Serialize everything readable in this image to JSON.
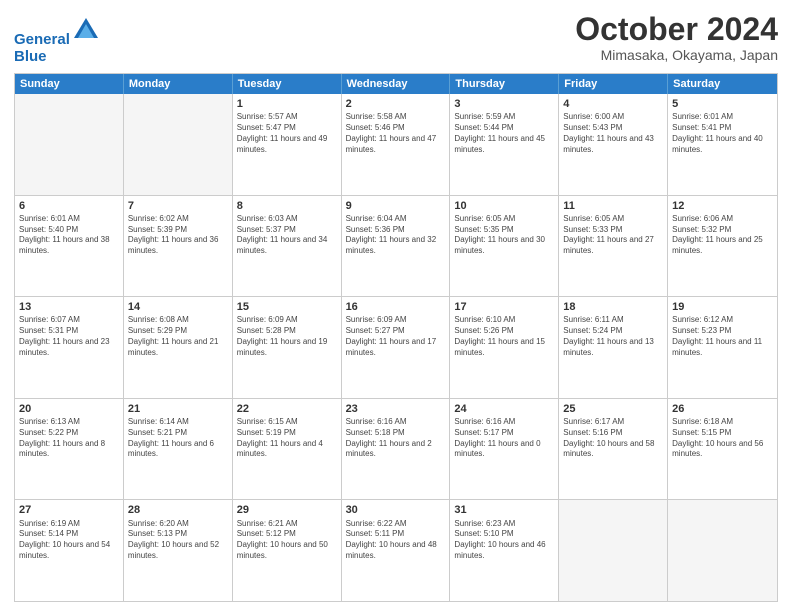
{
  "logo": {
    "line1": "General",
    "line2": "Blue"
  },
  "title": "October 2024",
  "subtitle": "Mimasaka, Okayama, Japan",
  "header_days": [
    "Sunday",
    "Monday",
    "Tuesday",
    "Wednesday",
    "Thursday",
    "Friday",
    "Saturday"
  ],
  "weeks": [
    [
      {
        "day": "",
        "info": ""
      },
      {
        "day": "",
        "info": ""
      },
      {
        "day": "1",
        "info": "Sunrise: 5:57 AM\nSunset: 5:47 PM\nDaylight: 11 hours and 49 minutes."
      },
      {
        "day": "2",
        "info": "Sunrise: 5:58 AM\nSunset: 5:46 PM\nDaylight: 11 hours and 47 minutes."
      },
      {
        "day": "3",
        "info": "Sunrise: 5:59 AM\nSunset: 5:44 PM\nDaylight: 11 hours and 45 minutes."
      },
      {
        "day": "4",
        "info": "Sunrise: 6:00 AM\nSunset: 5:43 PM\nDaylight: 11 hours and 43 minutes."
      },
      {
        "day": "5",
        "info": "Sunrise: 6:01 AM\nSunset: 5:41 PM\nDaylight: 11 hours and 40 minutes."
      }
    ],
    [
      {
        "day": "6",
        "info": "Sunrise: 6:01 AM\nSunset: 5:40 PM\nDaylight: 11 hours and 38 minutes."
      },
      {
        "day": "7",
        "info": "Sunrise: 6:02 AM\nSunset: 5:39 PM\nDaylight: 11 hours and 36 minutes."
      },
      {
        "day": "8",
        "info": "Sunrise: 6:03 AM\nSunset: 5:37 PM\nDaylight: 11 hours and 34 minutes."
      },
      {
        "day": "9",
        "info": "Sunrise: 6:04 AM\nSunset: 5:36 PM\nDaylight: 11 hours and 32 minutes."
      },
      {
        "day": "10",
        "info": "Sunrise: 6:05 AM\nSunset: 5:35 PM\nDaylight: 11 hours and 30 minutes."
      },
      {
        "day": "11",
        "info": "Sunrise: 6:05 AM\nSunset: 5:33 PM\nDaylight: 11 hours and 27 minutes."
      },
      {
        "day": "12",
        "info": "Sunrise: 6:06 AM\nSunset: 5:32 PM\nDaylight: 11 hours and 25 minutes."
      }
    ],
    [
      {
        "day": "13",
        "info": "Sunrise: 6:07 AM\nSunset: 5:31 PM\nDaylight: 11 hours and 23 minutes."
      },
      {
        "day": "14",
        "info": "Sunrise: 6:08 AM\nSunset: 5:29 PM\nDaylight: 11 hours and 21 minutes."
      },
      {
        "day": "15",
        "info": "Sunrise: 6:09 AM\nSunset: 5:28 PM\nDaylight: 11 hours and 19 minutes."
      },
      {
        "day": "16",
        "info": "Sunrise: 6:09 AM\nSunset: 5:27 PM\nDaylight: 11 hours and 17 minutes."
      },
      {
        "day": "17",
        "info": "Sunrise: 6:10 AM\nSunset: 5:26 PM\nDaylight: 11 hours and 15 minutes."
      },
      {
        "day": "18",
        "info": "Sunrise: 6:11 AM\nSunset: 5:24 PM\nDaylight: 11 hours and 13 minutes."
      },
      {
        "day": "19",
        "info": "Sunrise: 6:12 AM\nSunset: 5:23 PM\nDaylight: 11 hours and 11 minutes."
      }
    ],
    [
      {
        "day": "20",
        "info": "Sunrise: 6:13 AM\nSunset: 5:22 PM\nDaylight: 11 hours and 8 minutes."
      },
      {
        "day": "21",
        "info": "Sunrise: 6:14 AM\nSunset: 5:21 PM\nDaylight: 11 hours and 6 minutes."
      },
      {
        "day": "22",
        "info": "Sunrise: 6:15 AM\nSunset: 5:19 PM\nDaylight: 11 hours and 4 minutes."
      },
      {
        "day": "23",
        "info": "Sunrise: 6:16 AM\nSunset: 5:18 PM\nDaylight: 11 hours and 2 minutes."
      },
      {
        "day": "24",
        "info": "Sunrise: 6:16 AM\nSunset: 5:17 PM\nDaylight: 11 hours and 0 minutes."
      },
      {
        "day": "25",
        "info": "Sunrise: 6:17 AM\nSunset: 5:16 PM\nDaylight: 10 hours and 58 minutes."
      },
      {
        "day": "26",
        "info": "Sunrise: 6:18 AM\nSunset: 5:15 PM\nDaylight: 10 hours and 56 minutes."
      }
    ],
    [
      {
        "day": "27",
        "info": "Sunrise: 6:19 AM\nSunset: 5:14 PM\nDaylight: 10 hours and 54 minutes."
      },
      {
        "day": "28",
        "info": "Sunrise: 6:20 AM\nSunset: 5:13 PM\nDaylight: 10 hours and 52 minutes."
      },
      {
        "day": "29",
        "info": "Sunrise: 6:21 AM\nSunset: 5:12 PM\nDaylight: 10 hours and 50 minutes."
      },
      {
        "day": "30",
        "info": "Sunrise: 6:22 AM\nSunset: 5:11 PM\nDaylight: 10 hours and 48 minutes."
      },
      {
        "day": "31",
        "info": "Sunrise: 6:23 AM\nSunset: 5:10 PM\nDaylight: 10 hours and 46 minutes."
      },
      {
        "day": "",
        "info": ""
      },
      {
        "day": "",
        "info": ""
      }
    ]
  ]
}
